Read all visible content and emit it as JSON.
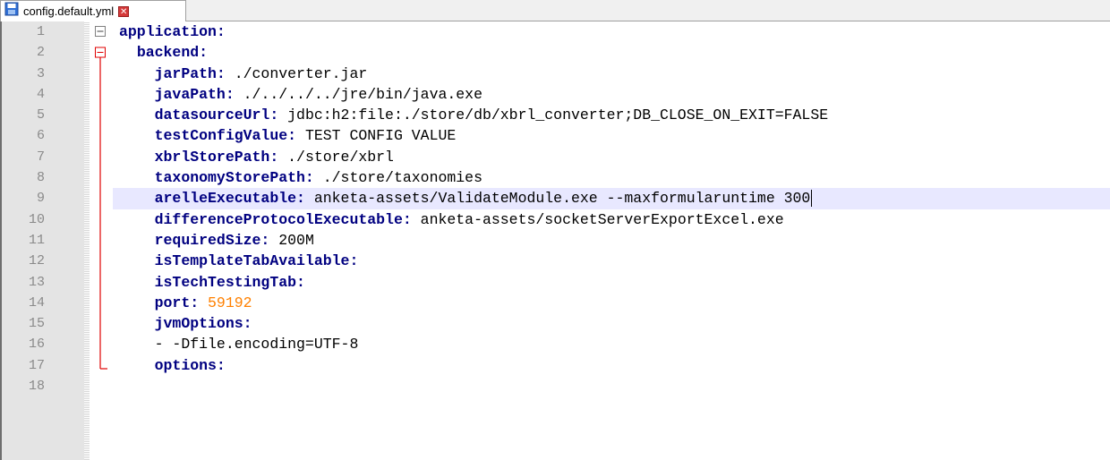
{
  "tab": {
    "title": "config.default.yml",
    "save_icon": "save-icon",
    "close_icon": "close-icon",
    "close_glyph": "✕"
  },
  "editor": {
    "current_line": 9,
    "lines": [
      {
        "n": "1",
        "indent": "",
        "key": "application:",
        "value": ""
      },
      {
        "n": "2",
        "indent": "  ",
        "key": "backend:",
        "value": ""
      },
      {
        "n": "3",
        "indent": "    ",
        "key": "jarPath:",
        "value": " ./converter.jar"
      },
      {
        "n": "4",
        "indent": "    ",
        "key": "javaPath:",
        "value": " ./../../../jre/bin/java.exe"
      },
      {
        "n": "5",
        "indent": "    ",
        "key": "datasourceUrl:",
        "value": " jdbc:h2:file:./store/db/xbrl_converter;DB_CLOSE_ON_EXIT=FALSE"
      },
      {
        "n": "6",
        "indent": "    ",
        "key": "testConfigValue:",
        "value": " TEST CONFIG VALUE"
      },
      {
        "n": "7",
        "indent": "    ",
        "key": "xbrlStorePath:",
        "value": " ./store/xbrl"
      },
      {
        "n": "8",
        "indent": "    ",
        "key": "taxonomyStorePath:",
        "value": " ./store/taxonomies"
      },
      {
        "n": "9",
        "indent": "    ",
        "key": "arelleExecutable:",
        "value": " anketa-assets/ValidateModule.exe --maxformularuntime 300"
      },
      {
        "n": "10",
        "indent": "    ",
        "key": "differenceProtocolExecutable:",
        "value": " anketa-assets/socketServerExportExcel.exe"
      },
      {
        "n": "11",
        "indent": "    ",
        "key": "requiredSize:",
        "value": " 200M"
      },
      {
        "n": "12",
        "indent": "    ",
        "key": "isTemplateTabAvailable:",
        "value": ""
      },
      {
        "n": "13",
        "indent": "    ",
        "key": "isTechTestingTab:",
        "value": ""
      },
      {
        "n": "14",
        "indent": "    ",
        "key": "port:",
        "value": "",
        "number": " 59192"
      },
      {
        "n": "15",
        "indent": "    ",
        "key": "jvmOptions:",
        "value": ""
      },
      {
        "n": "16",
        "indent": "    ",
        "key": "",
        "value": "- -Dfile.encoding=UTF-8"
      },
      {
        "n": "17",
        "indent": "    ",
        "key": "options:",
        "value": ""
      },
      {
        "n": "18",
        "indent": "",
        "key": "",
        "value": ""
      }
    ]
  },
  "colors": {
    "key": "#000080",
    "number": "#ff8000",
    "fold_red": "#e00000",
    "highlight": "#e8e8ff"
  }
}
